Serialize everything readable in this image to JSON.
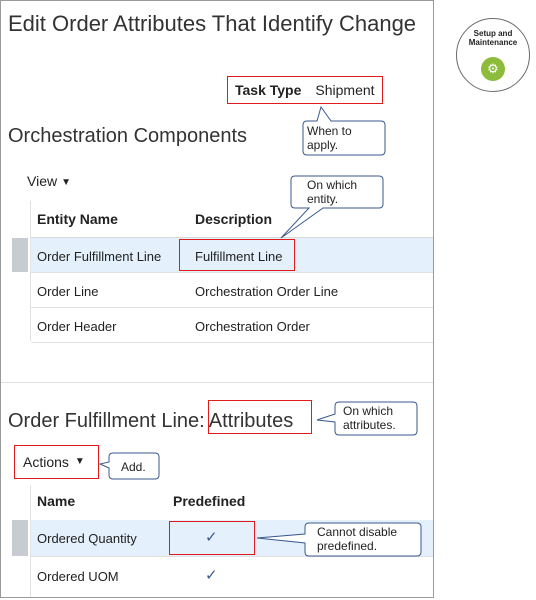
{
  "page": {
    "title": "Edit Order Attributes That Identify Change"
  },
  "task": {
    "label": "Task Type",
    "value": "Shipment"
  },
  "components": {
    "heading": "Orchestration Components",
    "view_label": "View",
    "columns": [
      "Entity Name",
      "Description"
    ],
    "rows": [
      {
        "entity": "Order Fulfillment Line",
        "description": "Fulfillment Line"
      },
      {
        "entity": "Order Line",
        "description": "Orchestration Order Line"
      },
      {
        "entity": "Order Header",
        "description": "Orchestration Order"
      }
    ]
  },
  "attributes": {
    "heading_prefix": "Order Fulfillment Line:",
    "heading_emph": "Attributes",
    "actions_label": "Actions",
    "columns": [
      "Name",
      "Predefined"
    ],
    "rows": [
      {
        "name": "Ordered Quantity",
        "predefined": "✓"
      },
      {
        "name": "Ordered UOM",
        "predefined": "✓"
      }
    ]
  },
  "callouts": {
    "when": "When to apply.",
    "entity": "On which entity.",
    "attrs": "On which attributes.",
    "add": "Add.",
    "cannot": "Cannot disable predefined."
  },
  "badge": {
    "text": "Setup and Maintenance",
    "icon": "gears-icon"
  },
  "colors": {
    "highlight_box": "#e21a1a",
    "selected_row": "#e4f0fb",
    "badge_icon": "#8dbb3c"
  }
}
